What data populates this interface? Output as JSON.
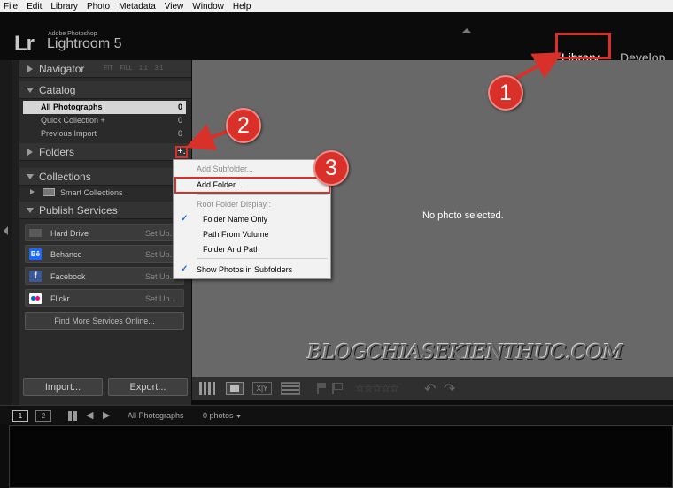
{
  "menubar": [
    "File",
    "Edit",
    "Library",
    "Photo",
    "Metadata",
    "View",
    "Window",
    "Help"
  ],
  "identity": {
    "logo": "Lr",
    "vendor": "Adobe Photoshop",
    "product": "Lightroom 5",
    "modules": {
      "library": "Library",
      "develop": "Develop"
    }
  },
  "left_panel": {
    "navigator": {
      "title": "Navigator",
      "zoom_options": "FIT FILL 1:1 3:1"
    },
    "catalog": {
      "title": "Catalog",
      "items": [
        {
          "label": "All Photographs",
          "count": "0",
          "selected": true
        },
        {
          "label": "Quick Collection +",
          "count": "0",
          "selected": false
        },
        {
          "label": "Previous Import",
          "count": "0",
          "selected": false
        }
      ]
    },
    "folders": {
      "title": "Folders",
      "add_icon": "+."
    },
    "collections": {
      "title": "Collections",
      "smart_collections": "Smart Collections"
    },
    "publish_services": {
      "title": "Publish Services",
      "services": [
        {
          "name": "Hard Drive",
          "setup": "Set Up...",
          "icon": "hard-drive-icon",
          "color": "#5a5a5a"
        },
        {
          "name": "Behance",
          "setup": "Set Up...",
          "icon": "behance-icon",
          "color": "#1769ff"
        },
        {
          "name": "Facebook",
          "setup": "Set Up...",
          "icon": "facebook-icon",
          "color": "#3b5998"
        },
        {
          "name": "Flickr",
          "setup": "Set Up...",
          "icon": "flickr-icon",
          "color": "#ffffff"
        }
      ],
      "find_more": "Find More Services Online..."
    },
    "import_label": "Import...",
    "export_label": "Export..."
  },
  "main": {
    "empty_message": "No photo selected.",
    "watermark": "BLOGCHIASEKIENTHUC.COM"
  },
  "toolbar": {
    "xy_label": "X|Y",
    "rating": "☆☆☆☆☆"
  },
  "filmstrip": {
    "screen1": "1",
    "screen2": "2",
    "source": "All Photographs",
    "count": "0 photos"
  },
  "context_menu": {
    "items": [
      {
        "label": "Add Subfolder...",
        "disabled": true,
        "checked": false
      },
      {
        "label": "Add Folder...",
        "disabled": false,
        "checked": false
      },
      {
        "label": "Root Folder Display :",
        "disabled": true,
        "checked": false
      },
      {
        "label": "Folder Name Only",
        "disabled": false,
        "checked": true
      },
      {
        "label": "Path From Volume",
        "disabled": false,
        "checked": false
      },
      {
        "label": "Folder And Path",
        "disabled": false,
        "checked": false
      },
      {
        "label": "Show Photos in Subfolders",
        "disabled": false,
        "checked": true
      }
    ]
  },
  "annotations": {
    "step1": "1",
    "step2": "2",
    "step3": "3",
    "color": "#d9302a"
  }
}
